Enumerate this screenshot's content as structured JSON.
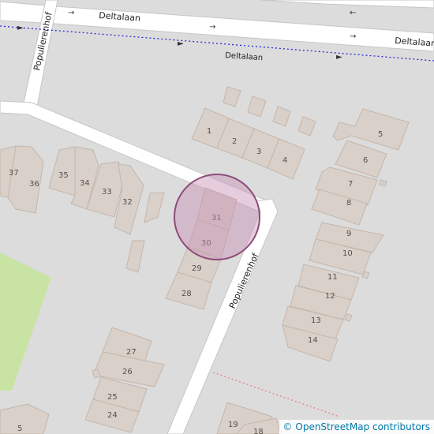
{
  "map": {
    "streets": {
      "top_road_label": "Deltalaan",
      "top_road_label_right": "Deltalaan",
      "path_label": "Deltalaan",
      "left_road_label": "Populierenhof",
      "right_road_label": "Populierenhof"
    },
    "house_numbers": [
      "1",
      "2",
      "3",
      "4",
      "5",
      "6",
      "7",
      "8",
      "9",
      "10",
      "11",
      "12",
      "13",
      "14",
      "37",
      "36",
      "35",
      "34",
      "33",
      "32",
      "31",
      "30",
      "29",
      "28",
      "27",
      "26",
      "25",
      "24",
      "5",
      "19",
      "18"
    ],
    "marker": {
      "fill": "#d7a5c6",
      "stroke": "#8c4c7a"
    },
    "colors": {
      "background": "#dcdcdc",
      "building": "#d9d0c9",
      "park": "#c9e3a4",
      "road": "#ffffff",
      "path_blue": "#2a2acf",
      "path_red": "#f08080"
    },
    "attribution": {
      "symbol": "©",
      "text": "OpenStreetMap contributors"
    }
  }
}
